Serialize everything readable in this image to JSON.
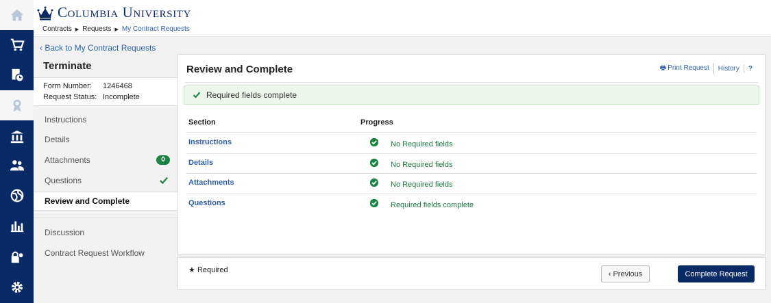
{
  "header": {
    "brand": "Columbia University",
    "breadcrumb": [
      "Contracts",
      "Requests",
      "My Contract Requests"
    ]
  },
  "back_link": "‹ Back to My Contract Requests",
  "leftnav": {
    "title": "Terminate",
    "form_number_label": "Form Number:",
    "form_number": "1246468",
    "status_label": "Request Status:",
    "status": "Incomplete",
    "items": [
      {
        "label": "Instructions"
      },
      {
        "label": "Details"
      },
      {
        "label": "Attachments",
        "badge": "0"
      },
      {
        "label": "Questions"
      },
      {
        "label": "Review and Complete"
      },
      {
        "label": "Discussion"
      },
      {
        "label": "Contract Request Workflow"
      }
    ]
  },
  "main": {
    "title": "Review and Complete",
    "links": {
      "print": "Print Request",
      "history": "History",
      "help": "?"
    },
    "alert": "Required fields complete",
    "columns": {
      "section": "Section",
      "progress": "Progress"
    },
    "rows": [
      {
        "section": "Instructions",
        "progress": "No Required fields"
      },
      {
        "section": "Details",
        "progress": "No Required fields"
      },
      {
        "section": "Attachments",
        "progress": "No Required fields"
      },
      {
        "section": "Questions",
        "progress": "Required fields complete"
      }
    ]
  },
  "footer": {
    "required": "Required",
    "previous": "‹ Previous",
    "complete": "Complete Request"
  },
  "colors": {
    "navy": "#0a2a66",
    "link": "#2e5fa8",
    "success": "#1d8345"
  }
}
